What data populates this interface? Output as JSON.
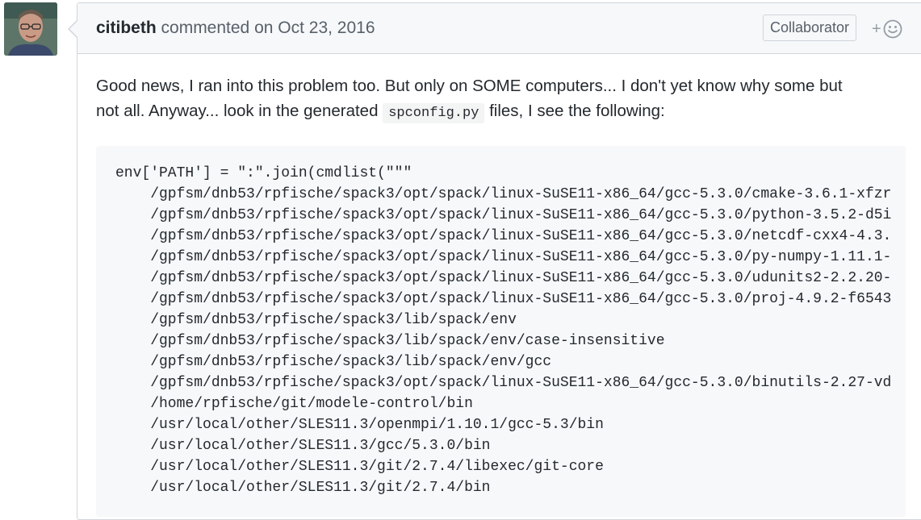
{
  "comment": {
    "author": "citibeth",
    "action": "commented on",
    "date": "Oct 23, 2016",
    "badge": "Collaborator",
    "reaction_plus": "+"
  },
  "body": {
    "line1": "Good news, I ran into this problem too. But only on SOME computers... I don't yet know why some but",
    "line2_before": "not all. Anyway... look in the generated ",
    "inline_code": "spconfig.py",
    "line2_after": " files, I see the following:"
  },
  "code": {
    "lines": [
      "env['PATH'] = \":\".join(cmdlist(\"\"\"",
      "    /gpfsm/dnb53/rpfische/spack3/opt/spack/linux-SuSE11-x86_64/gcc-5.3.0/cmake-3.6.1-xfzr",
      "    /gpfsm/dnb53/rpfische/spack3/opt/spack/linux-SuSE11-x86_64/gcc-5.3.0/python-3.5.2-d5i",
      "    /gpfsm/dnb53/rpfische/spack3/opt/spack/linux-SuSE11-x86_64/gcc-5.3.0/netcdf-cxx4-4.3.",
      "    /gpfsm/dnb53/rpfische/spack3/opt/spack/linux-SuSE11-x86_64/gcc-5.3.0/py-numpy-1.11.1-",
      "    /gpfsm/dnb53/rpfische/spack3/opt/spack/linux-SuSE11-x86_64/gcc-5.3.0/udunits2-2.2.20-",
      "    /gpfsm/dnb53/rpfische/spack3/opt/spack/linux-SuSE11-x86_64/gcc-5.3.0/proj-4.9.2-f6543",
      "    /gpfsm/dnb53/rpfische/spack3/lib/spack/env",
      "    /gpfsm/dnb53/rpfische/spack3/lib/spack/env/case-insensitive",
      "    /gpfsm/dnb53/rpfische/spack3/lib/spack/env/gcc",
      "    /gpfsm/dnb53/rpfische/spack3/opt/spack/linux-SuSE11-x86_64/gcc-5.3.0/binutils-2.27-vd",
      "    /home/rpfische/git/modele-control/bin",
      "    /usr/local/other/SLES11.3/openmpi/1.10.1/gcc-5.3/bin",
      "    /usr/local/other/SLES11.3/gcc/5.3.0/bin",
      "    /usr/local/other/SLES11.3/git/2.7.4/libexec/git-core",
      "    /usr/local/other/SLES11.3/git/2.7.4/bin"
    ]
  },
  "icons": {
    "avatar": "user-avatar",
    "reaction": "smiley-icon"
  }
}
